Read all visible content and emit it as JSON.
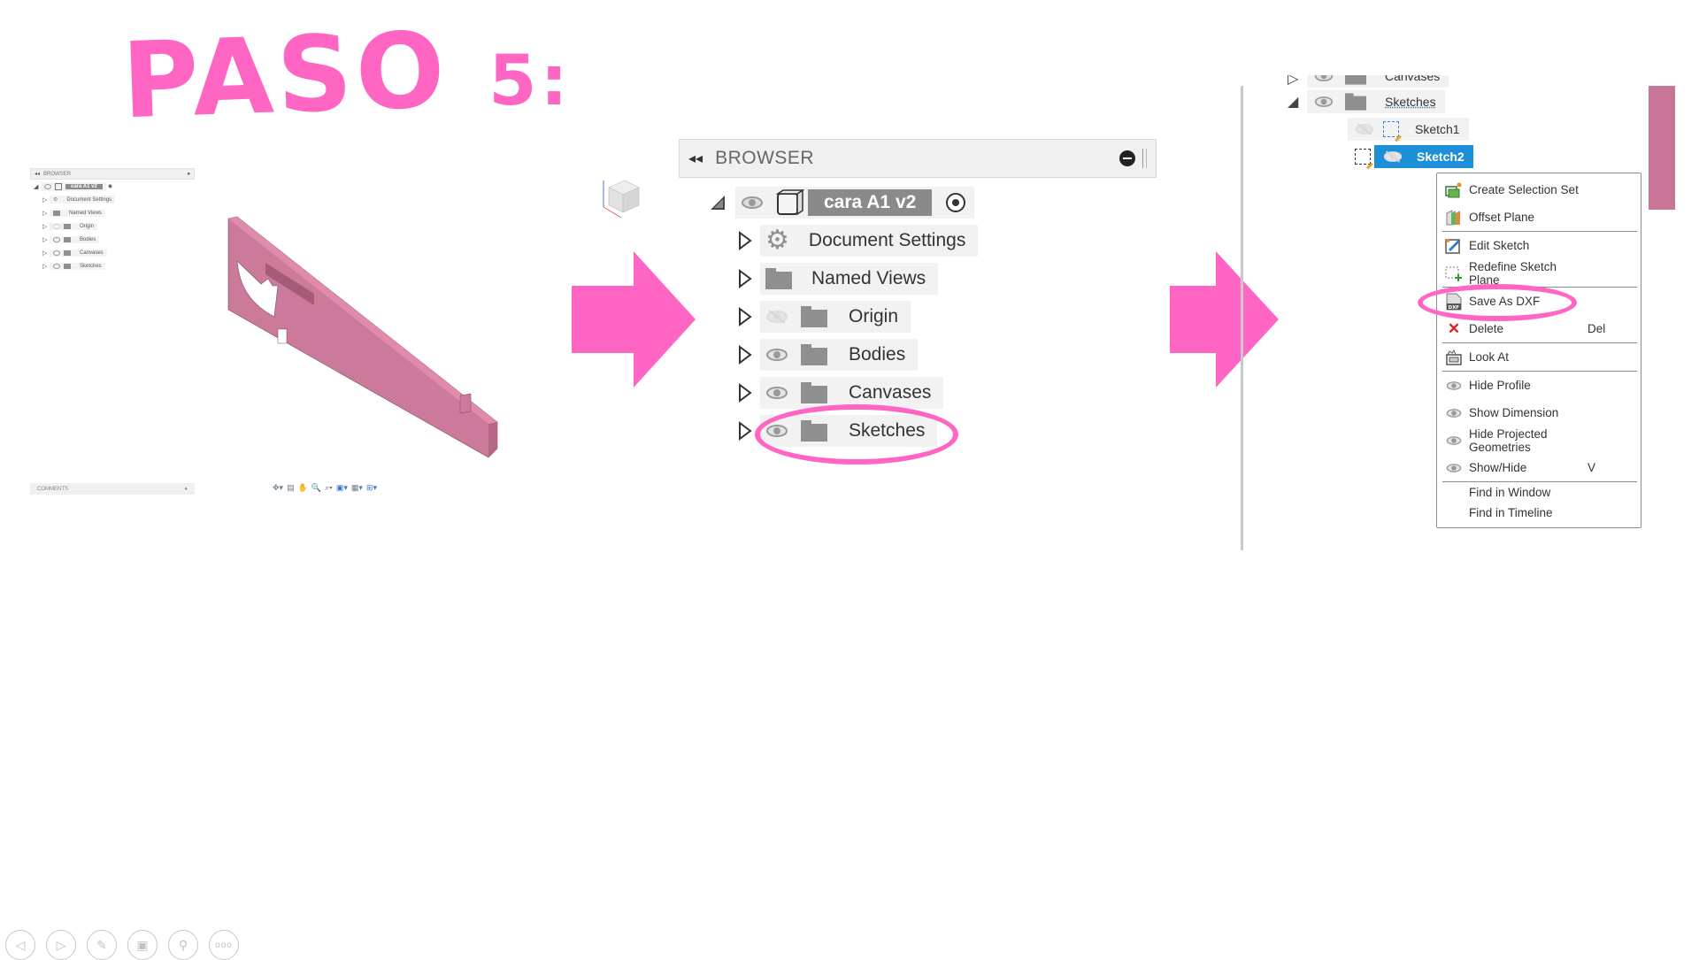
{
  "slide": {
    "title": "PASO",
    "step_number": "5:",
    "accent_color": "#ff66c4"
  },
  "thumbnail": {
    "browser": {
      "header": "BROWSER",
      "root": "cara A1 v2",
      "items": [
        {
          "label": "Document Settings",
          "icon": "gear-icon"
        },
        {
          "label": "Named Views",
          "icon": "folder-icon"
        },
        {
          "label": "Origin",
          "icon": "folder-icon",
          "visible": false
        },
        {
          "label": "Bodies",
          "icon": "folder-icon",
          "visible": true
        },
        {
          "label": "Canvases",
          "icon": "folder-icon",
          "visible": true
        },
        {
          "label": "Sketches",
          "icon": "folder-icon",
          "visible": true
        }
      ]
    },
    "comments_label": "COMMENTS",
    "nav_toolbar": [
      "orbit-icon",
      "look-at-icon",
      "pan-icon",
      "zoom-window-icon",
      "zoom-icon",
      "display-settings-icon",
      "grid-icon",
      "viewports-icon"
    ],
    "model_color": "#c97a9b"
  },
  "browser_panel": {
    "header": "BROWSER",
    "root": {
      "label": "cara A1 v2"
    },
    "items": [
      {
        "label": "Document Settings",
        "icon": "gear-icon",
        "eye": "none"
      },
      {
        "label": "Named Views",
        "icon": "folder-icon",
        "eye": "none"
      },
      {
        "label": "Origin",
        "icon": "folder-icon",
        "eye": "hidden"
      },
      {
        "label": "Bodies",
        "icon": "folder-icon",
        "eye": "visible"
      },
      {
        "label": "Canvases",
        "icon": "folder-icon",
        "eye": "visible"
      },
      {
        "label": "Sketches",
        "icon": "folder-icon",
        "eye": "visible",
        "highlighted": true
      }
    ]
  },
  "sketch_panel": {
    "tree": [
      {
        "label": "Canvases",
        "partial": true
      },
      {
        "label": "Sketches",
        "expanded": true
      },
      {
        "label": "Sketch1",
        "selected": false
      },
      {
        "label": "Sketch2",
        "selected": true
      }
    ],
    "selection_color": "#1d8fd8"
  },
  "context_menu": {
    "items": [
      {
        "label": "Create Selection Set",
        "shortcut": "",
        "icon": "selection-set-icon"
      },
      {
        "label": "Offset Plane",
        "shortcut": "",
        "icon": "offset-plane-icon",
        "sep_after": true
      },
      {
        "label": "Edit Sketch",
        "shortcut": "",
        "icon": "edit-sketch-icon"
      },
      {
        "label": "Redefine Sketch Plane",
        "shortcut": "",
        "icon": "redefine-plane-icon",
        "sep_after": true
      },
      {
        "label": "Save As DXF",
        "shortcut": "",
        "icon": "dxf-icon",
        "highlighted": true
      },
      {
        "label": "Delete",
        "shortcut": "Del",
        "icon": "delete-icon",
        "sep_after": true
      },
      {
        "label": "Look At",
        "shortcut": "",
        "icon": "look-at-icon",
        "sep_after": true
      },
      {
        "label": "Hide Profile",
        "shortcut": "",
        "icon": "eye-icon"
      },
      {
        "label": "Show Dimension",
        "shortcut": "",
        "icon": "eye-icon"
      },
      {
        "label": "Hide Projected Geometries",
        "shortcut": "",
        "icon": "eye-icon"
      },
      {
        "label": "Show/Hide",
        "shortcut": "V",
        "icon": "eye-icon",
        "sep_after": true
      },
      {
        "label": "Find in Window",
        "shortcut": "",
        "icon": ""
      },
      {
        "label": "Find in Timeline",
        "shortcut": "",
        "icon": ""
      }
    ]
  },
  "slideshow_controls": [
    {
      "name": "previous-slide",
      "icon": "triangle-left-icon"
    },
    {
      "name": "next-slide",
      "icon": "triangle-right-icon"
    },
    {
      "name": "pen-tool",
      "icon": "pen-icon"
    },
    {
      "name": "see-all-slides",
      "icon": "slides-grid-icon"
    },
    {
      "name": "zoom-slide",
      "icon": "magnifier-icon"
    },
    {
      "name": "more-options",
      "icon": "more-icon"
    }
  ]
}
